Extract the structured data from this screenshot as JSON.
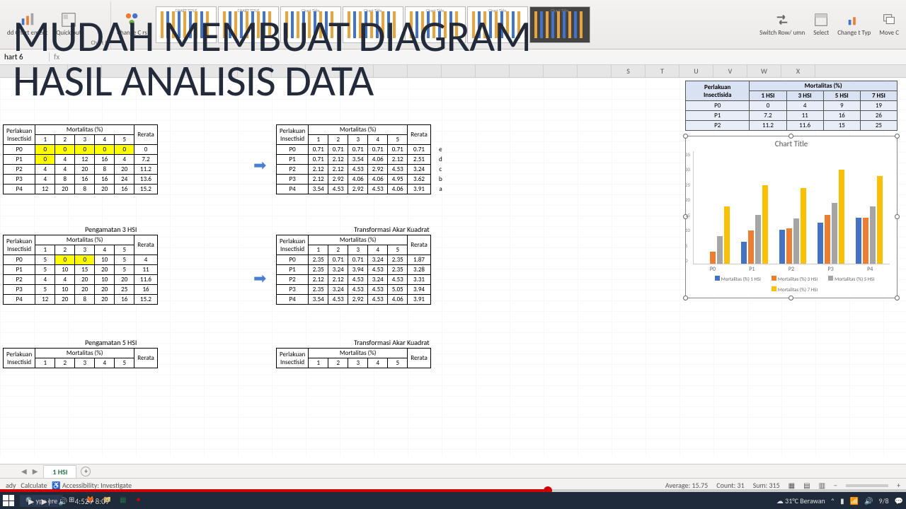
{
  "ribbon": {
    "btns": [
      "dd Chart\nement",
      "Quick\nout",
      "Change\nC    rs",
      "Switch Row/\numn",
      "Select\n",
      "Change\nt Typ",
      "Move\nC"
    ],
    "group_label": "Chart I"
  },
  "thumbs": [
    "CHART TITLE",
    "CHART TITLE",
    "Chart Title",
    "Chart Title",
    "Chart Title",
    "Chart Title",
    "Chart Title"
  ],
  "overlay": {
    "line1": "MUDAH MEMBUAT DIAGRAM",
    "line2": "HASIL ANALISIS DATA"
  },
  "cellref": {
    "name": "hart 6",
    "fx": "fx"
  },
  "columns": [
    "",
    "",
    "",
    "",
    "",
    "",
    "",
    "",
    "",
    "",
    "",
    "",
    "",
    "",
    "",
    "",
    "",
    "",
    "S",
    "T",
    "U",
    "V",
    "W",
    "X"
  ],
  "sections": {
    "t1_title": "",
    "t2_title": "",
    "t3_title": "Pengamatan 3 HSI",
    "t4_title": "Transformasi Akar Kuadrat",
    "t5_title": "Pengamatan 5 HSI",
    "t6_title": "Transformasi Akar Kuadrat"
  },
  "hdr": {
    "perlakuan": "Perlakuan",
    "insectisid": "Insectisid",
    "mortal": "Mortalitas (%)",
    "rerata": "Rerata",
    "cols": [
      "1",
      "2",
      "3",
      "4",
      "5"
    ]
  },
  "t1": {
    "rows": [
      {
        "p": "P0",
        "v": [
          "0",
          "0",
          "0",
          "0",
          "0"
        ],
        "r": "0",
        "hl": [
          0,
          1,
          2,
          3,
          4
        ]
      },
      {
        "p": "P1",
        "v": [
          "0",
          "4",
          "12",
          "16",
          "4"
        ],
        "r": "7.2",
        "hl": [
          0
        ]
      },
      {
        "p": "P2",
        "v": [
          "4",
          "4",
          "20",
          "8",
          "20"
        ],
        "r": "11.2"
      },
      {
        "p": "P3",
        "v": [
          "4",
          "8",
          "16",
          "16",
          "24"
        ],
        "r": "13.6"
      },
      {
        "p": "P4",
        "v": [
          "12",
          "20",
          "8",
          "20",
          "16"
        ],
        "r": "15.2"
      }
    ]
  },
  "t2": {
    "rows": [
      {
        "p": "P0",
        "v": [
          "0.71",
          "0.71",
          "0.71",
          "0.71",
          "0.71"
        ],
        "r": "0.71",
        "g": "e"
      },
      {
        "p": "P1",
        "v": [
          "0.71",
          "2.12",
          "3.54",
          "4.06",
          "2.12"
        ],
        "r": "2.51",
        "g": "d"
      },
      {
        "p": "P2",
        "v": [
          "2.12",
          "2.12",
          "4.53",
          "2.92",
          "4.53"
        ],
        "r": "3.24",
        "g": "c"
      },
      {
        "p": "P3",
        "v": [
          "2.12",
          "2.92",
          "4.06",
          "4.06",
          "4.95"
        ],
        "r": "3.62",
        "g": "b"
      },
      {
        "p": "P4",
        "v": [
          "3.54",
          "4.53",
          "2.92",
          "4.53",
          "4.06"
        ],
        "r": "3.91",
        "g": "a"
      }
    ]
  },
  "t3": {
    "rows": [
      {
        "p": "P0",
        "v": [
          "5",
          "0",
          "0",
          "10",
          "5"
        ],
        "r": "4",
        "hl": [
          1,
          2
        ]
      },
      {
        "p": "P1",
        "v": [
          "5",
          "10",
          "15",
          "20",
          "5"
        ],
        "r": "11"
      },
      {
        "p": "P2",
        "v": [
          "4",
          "4",
          "20",
          "10",
          "20"
        ],
        "r": "11.6"
      },
      {
        "p": "P3",
        "v": [
          "5",
          "10",
          "20",
          "20",
          "25"
        ],
        "r": "16"
      },
      {
        "p": "P4",
        "v": [
          "12",
          "20",
          "8",
          "20",
          "16"
        ],
        "r": "15.2"
      }
    ]
  },
  "t4": {
    "rows": [
      {
        "p": "P0",
        "v": [
          "2.35",
          "0.71",
          "0.71",
          "3.24",
          "2.35"
        ],
        "r": "1.87"
      },
      {
        "p": "P1",
        "v": [
          "2.35",
          "3.24",
          "3.94",
          "4.53",
          "2.35"
        ],
        "r": "3.28"
      },
      {
        "p": "P2",
        "v": [
          "2.12",
          "2.12",
          "4.53",
          "3.24",
          "4.53"
        ],
        "r": "3.31"
      },
      {
        "p": "P3",
        "v": [
          "2.35",
          "3.24",
          "4.53",
          "4.53",
          "5.05"
        ],
        "r": "3.94"
      },
      {
        "p": "P4",
        "v": [
          "3.54",
          "4.53",
          "2.92",
          "4.53",
          "4.06"
        ],
        "r": "3.91"
      }
    ]
  },
  "right_table": {
    "hdr": {
      "perlakuan": "Perlakuan",
      "insectisida": "Insectisida",
      "mortal": "Mortalitas (%)",
      "cols": [
        "1 HSI",
        "3 HSI",
        "5 HSI",
        "7 HSI"
      ]
    },
    "rows": [
      {
        "p": "P0",
        "v": [
          "0",
          "4",
          "9",
          "19"
        ]
      },
      {
        "p": "P1",
        "v": [
          "7.2",
          "11",
          "16",
          "26"
        ]
      },
      {
        "p": "P2",
        "v": [
          "11.2",
          "11.6",
          "15",
          "25"
        ]
      }
    ]
  },
  "chart_data": {
    "type": "bar",
    "title": "Chart Title",
    "categories": [
      "P0",
      "P1",
      "P2",
      "P3",
      "P4"
    ],
    "series": [
      {
        "name": "Mortalitas (%) 1 HSI",
        "values": [
          0,
          7.2,
          11.2,
          13.6,
          15.2
        ],
        "color": "#4472c4"
      },
      {
        "name": "Mortalitas (%) 3 HSI",
        "values": [
          4,
          11,
          11.6,
          16,
          15.2
        ],
        "color": "#ed7d31"
      },
      {
        "name": "Mortalitas (%) 5 HSI",
        "values": [
          9,
          16,
          15,
          20,
          19
        ],
        "color": "#a5a5a5"
      },
      {
        "name": "Mortalitas (%) 7 HSI",
        "values": [
          19,
          26,
          25,
          31,
          29
        ],
        "color": "#ffc000"
      }
    ],
    "ylim": [
      0,
      35
    ],
    "yticks": [
      "0",
      "5",
      "10",
      "15",
      "20",
      "25",
      "30",
      "35"
    ]
  },
  "tabs": {
    "active": "1 HSI",
    "plus": "+"
  },
  "status": {
    "left": [
      "ady",
      "Calculate",
      "Accessibility: Investigate"
    ],
    "avg": "Average: 15.75",
    "count": "Count: 31",
    "sum": "Sum: 315",
    "zoom": "+"
  },
  "video": {
    "time": "4:52 / 8:09",
    "search_placeholder": "ype ere"
  },
  "taskbar": {
    "weather": "31°C  Berawan",
    "time": "9/8"
  }
}
